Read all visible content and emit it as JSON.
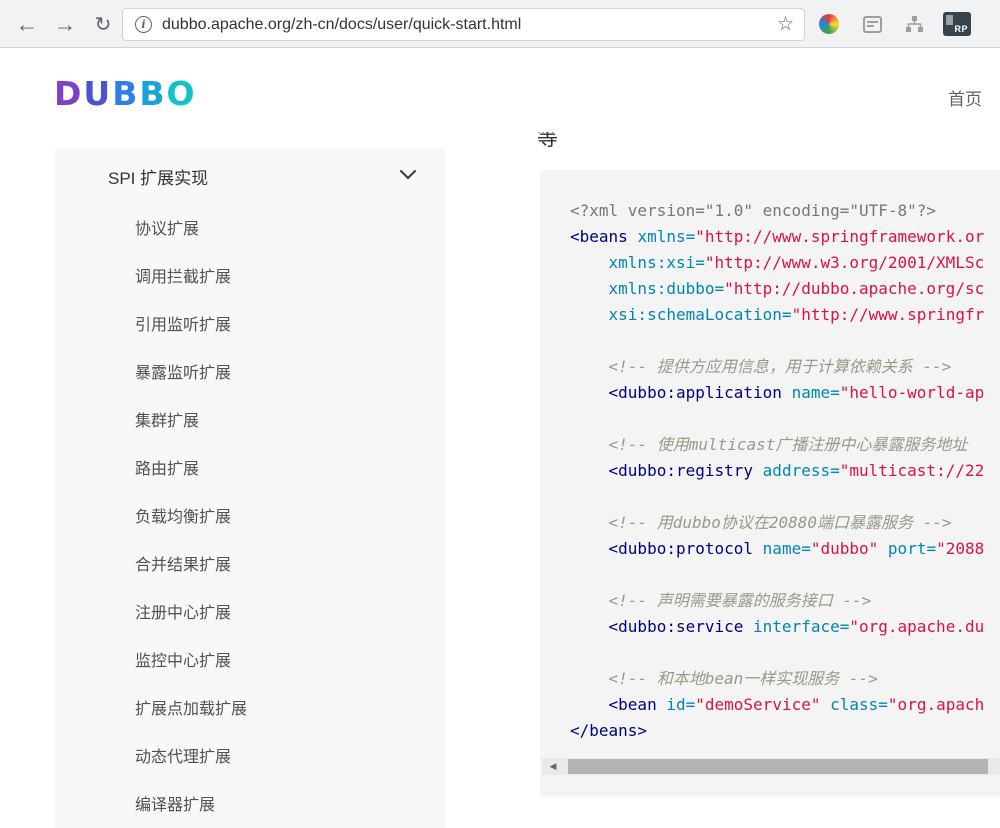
{
  "browser": {
    "url": "dubbo.apache.org/zh-cn/docs/user/quick-start.html",
    "back_icon": "←",
    "forward_icon": "→",
    "reload_icon": "↻",
    "info_glyph": "i",
    "star_icon": "☆",
    "rp_badge": "RP"
  },
  "header": {
    "logo_letters": [
      {
        "ch": "D",
        "color": "#7d41c9"
      },
      {
        "ch": "U",
        "color": "#4a54d1"
      },
      {
        "ch": "B",
        "color": "#2e7ee5"
      },
      {
        "ch": "B",
        "color": "#18a5d6"
      },
      {
        "ch": "O",
        "color": "#12c2c9"
      }
    ],
    "nav_home": "首页"
  },
  "content": {
    "clipped_heading_char": "等"
  },
  "sidebar": {
    "section_label": "SPI 扩展实现",
    "items": [
      "协议扩展",
      "调用拦截扩展",
      "引用监听扩展",
      "暴露监听扩展",
      "集群扩展",
      "路由扩展",
      "负载均衡扩展",
      "合并结果扩展",
      "注册中心扩展",
      "监控中心扩展",
      "扩展点加载扩展",
      "动态代理扩展",
      "编译器扩展"
    ]
  },
  "code": {
    "scroll_left_icon": "◀",
    "background": "#f4f4f5",
    "token_colors": {
      "meta": "#777777",
      "tag": "#000080",
      "attr": "#0086b3",
      "str": "#dd1144",
      "comment": "#999988",
      "plain": "#333333"
    },
    "lines": [
      [
        {
          "t": "meta",
          "s": "<?xml version=\"1.0\" encoding=\"UTF-8\"?>"
        }
      ],
      [
        {
          "t": "tag",
          "s": "<beans"
        },
        {
          "t": "plain",
          "s": " "
        },
        {
          "t": "attr",
          "s": "xmlns="
        },
        {
          "t": "str",
          "s": "\"http://www.springframework.or"
        }
      ],
      [
        {
          "t": "plain",
          "s": "    "
        },
        {
          "t": "attr",
          "s": "xmlns:xsi="
        },
        {
          "t": "str",
          "s": "\"http://www.w3.org/2001/XMLSc"
        }
      ],
      [
        {
          "t": "plain",
          "s": "    "
        },
        {
          "t": "attr",
          "s": "xmlns:dubbo="
        },
        {
          "t": "str",
          "s": "\"http://dubbo.apache.org/sc"
        }
      ],
      [
        {
          "t": "plain",
          "s": "    "
        },
        {
          "t": "attr",
          "s": "xsi:schemaLocation="
        },
        {
          "t": "str",
          "s": "\"http://www.springfr"
        }
      ],
      [],
      [
        {
          "t": "plain",
          "s": "    "
        },
        {
          "t": "comment",
          "s": "<!-- 提供方应用信息，用于计算依赖关系 -->"
        }
      ],
      [
        {
          "t": "plain",
          "s": "    "
        },
        {
          "t": "tag",
          "s": "<dubbo:application"
        },
        {
          "t": "plain",
          "s": " "
        },
        {
          "t": "attr",
          "s": "name="
        },
        {
          "t": "str",
          "s": "\"hello-world-ap"
        }
      ],
      [],
      [
        {
          "t": "plain",
          "s": "    "
        },
        {
          "t": "comment",
          "s": "<!-- 使用multicast广播注册中心暴露服务地址"
        }
      ],
      [
        {
          "t": "plain",
          "s": "    "
        },
        {
          "t": "tag",
          "s": "<dubbo:registry"
        },
        {
          "t": "plain",
          "s": " "
        },
        {
          "t": "attr",
          "s": "address="
        },
        {
          "t": "str",
          "s": "\"multicast://22"
        }
      ],
      [],
      [
        {
          "t": "plain",
          "s": "    "
        },
        {
          "t": "comment",
          "s": "<!-- 用dubbo协议在20880端口暴露服务 -->"
        }
      ],
      [
        {
          "t": "plain",
          "s": "    "
        },
        {
          "t": "tag",
          "s": "<dubbo:protocol"
        },
        {
          "t": "plain",
          "s": " "
        },
        {
          "t": "attr",
          "s": "name="
        },
        {
          "t": "str",
          "s": "\"dubbo\""
        },
        {
          "t": "plain",
          "s": " "
        },
        {
          "t": "attr",
          "s": "port="
        },
        {
          "t": "str",
          "s": "\"2088"
        }
      ],
      [],
      [
        {
          "t": "plain",
          "s": "    "
        },
        {
          "t": "comment",
          "s": "<!-- 声明需要暴露的服务接口 -->"
        }
      ],
      [
        {
          "t": "plain",
          "s": "    "
        },
        {
          "t": "tag",
          "s": "<dubbo:service"
        },
        {
          "t": "plain",
          "s": " "
        },
        {
          "t": "attr",
          "s": "interface="
        },
        {
          "t": "str",
          "s": "\"org.apache.du"
        }
      ],
      [],
      [
        {
          "t": "plain",
          "s": "    "
        },
        {
          "t": "comment",
          "s": "<!-- 和本地bean一样实现服务 -->"
        }
      ],
      [
        {
          "t": "plain",
          "s": "    "
        },
        {
          "t": "tag",
          "s": "<bean"
        },
        {
          "t": "plain",
          "s": " "
        },
        {
          "t": "attr",
          "s": "id="
        },
        {
          "t": "str",
          "s": "\"demoService\""
        },
        {
          "t": "plain",
          "s": " "
        },
        {
          "t": "attr",
          "s": "class="
        },
        {
          "t": "str",
          "s": "\"org.apach"
        }
      ],
      [
        {
          "t": "tag",
          "s": "</beans>"
        }
      ]
    ]
  }
}
